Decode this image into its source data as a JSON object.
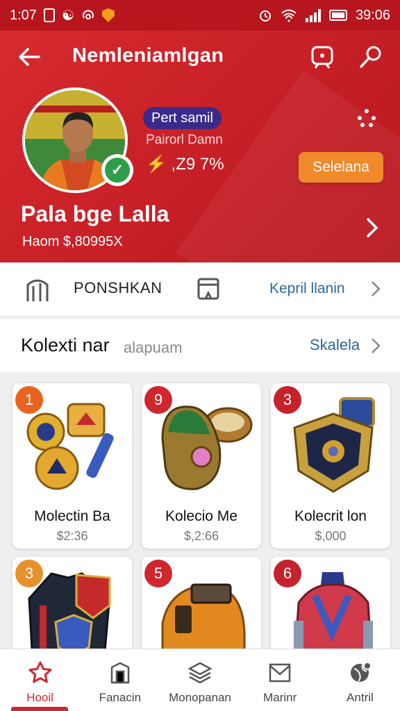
{
  "status_bar": {
    "time": "1:07",
    "clock": "39:06",
    "icons": [
      "sim-icon",
      "vibrate-icon",
      "hotspot-icon",
      "shield-icon",
      "alarm-icon",
      "wifi-icon",
      "signal-icon",
      "battery-icon"
    ]
  },
  "header": {
    "title": "Nemleniamlgan",
    "back_icon": "back-arrow-icon",
    "actions": [
      "chat-icon",
      "search-icon"
    ]
  },
  "profile": {
    "badge": "Pert samil",
    "subname": "Pairorl Damn",
    "stat": "⚡ ,Z9 7%",
    "cta_label": "Selelana",
    "name": "Pala bge Lalla",
    "balance": "Haom $,80995X"
  },
  "quick_bar": {
    "label": "PONSHKAN",
    "link": "Kepril llanin"
  },
  "collection": {
    "title": "Kolexti nar",
    "subtitle": "alapuam",
    "link": "Skalela"
  },
  "items": [
    {
      "rank": "1",
      "name": "Molectin Ba",
      "price": "$2:36",
      "rank_color": "#e8641e"
    },
    {
      "rank": "9",
      "name": "Kolecio Me",
      "price": "$,2:66",
      "rank_color": "#d0262e"
    },
    {
      "rank": "3",
      "name": "Kolecrit lon",
      "price": "$,000",
      "rank_color": "#c4232c"
    },
    {
      "rank": "3",
      "name": "",
      "price": "",
      "rank_color": "#e8902a"
    },
    {
      "rank": "5",
      "name": "",
      "price": "",
      "rank_color": "#d0262e"
    },
    {
      "rank": "6",
      "name": "",
      "price": "",
      "rank_color": "#c4232c"
    }
  ],
  "nav": [
    {
      "label": "Hooil",
      "icon": "star-icon",
      "active": true
    },
    {
      "label": "Fanacin",
      "icon": "building-icon",
      "active": false
    },
    {
      "label": "Monopanan",
      "icon": "layers-icon",
      "active": false
    },
    {
      "label": "Marinr",
      "icon": "mail-icon",
      "active": false
    },
    {
      "label": "Antril",
      "icon": "globe-icon",
      "active": false
    }
  ],
  "colors": {
    "primary": "#c61f26",
    "accent": "#f08a2a",
    "link": "#2a6a9a",
    "badge": "#3a2a8a"
  }
}
